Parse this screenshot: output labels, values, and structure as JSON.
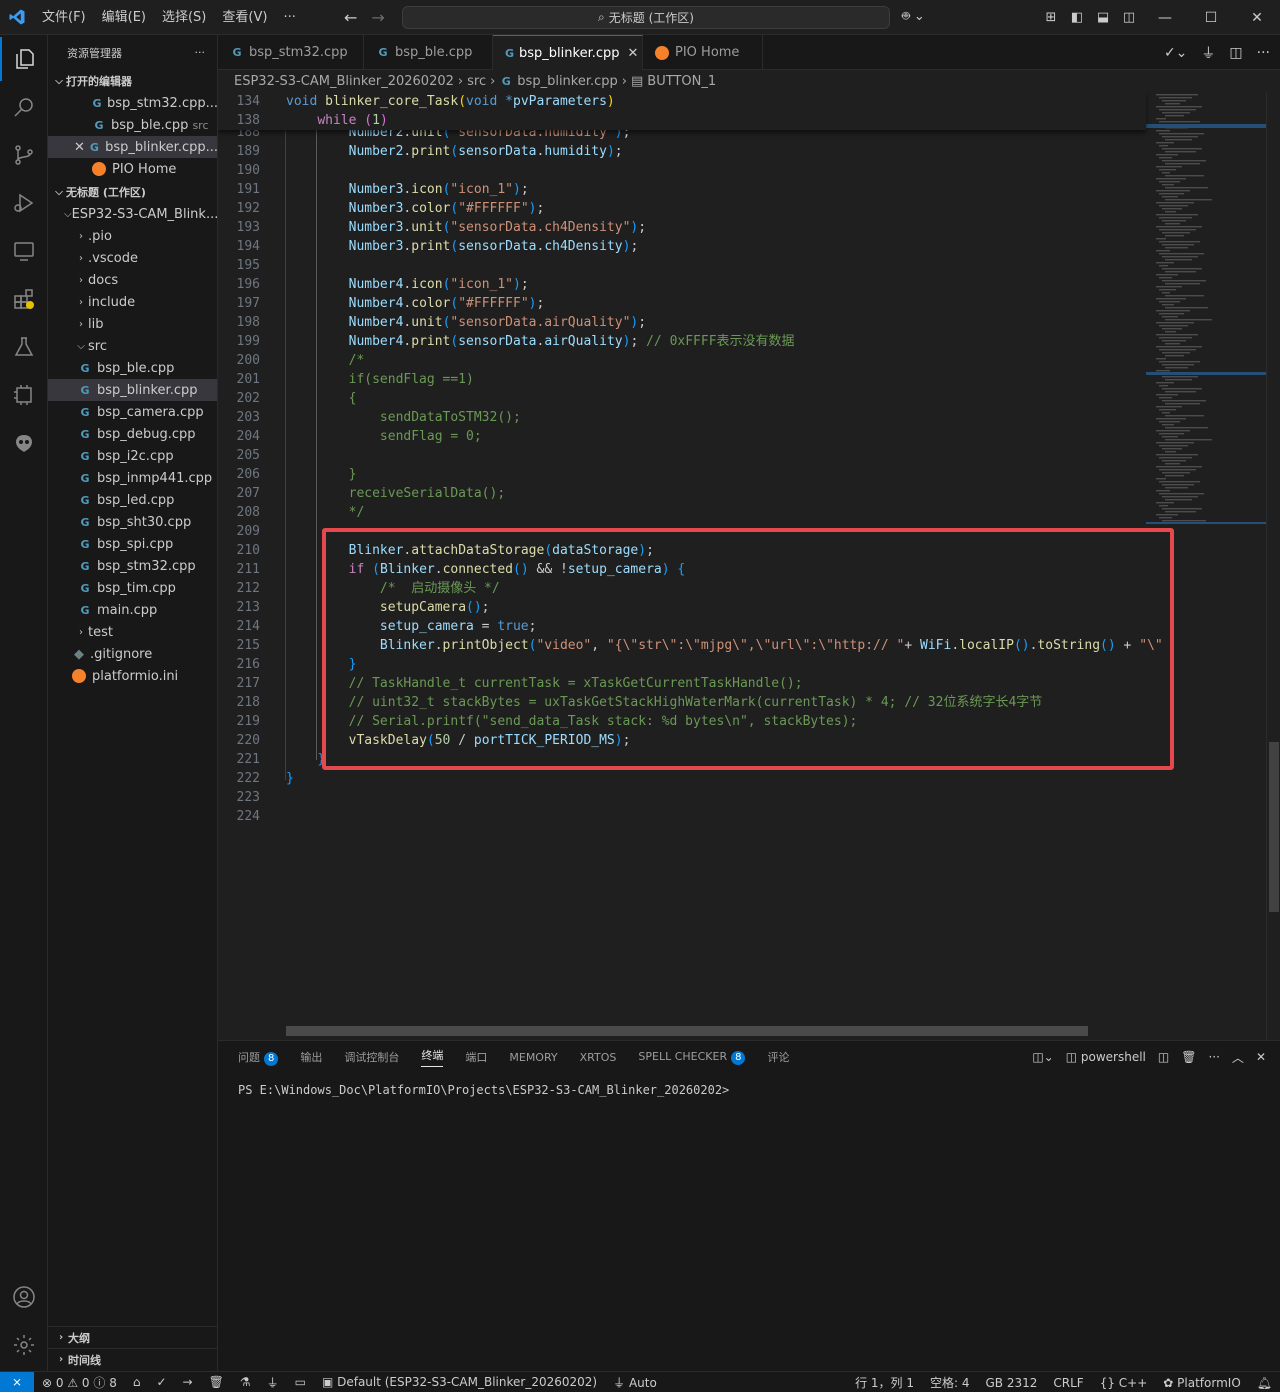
{
  "titlebar": {
    "menu": [
      "文件(F)",
      "编辑(E)",
      "选择(S)",
      "查看(V)",
      "···"
    ],
    "search": "无标题 (工作区)"
  },
  "sidebar": {
    "title": "资源管理器",
    "open_editors_title": "打开的编辑器",
    "open_editors": [
      {
        "label": "bsp_stm32.cpp...",
        "hint": ""
      },
      {
        "label": "bsp_ble.cpp",
        "hint": "src"
      },
      {
        "label": "bsp_blinker.cpp...",
        "hint": ""
      },
      {
        "label": "PIO Home",
        "hint": ""
      }
    ],
    "workspace_title": "无标题 (工作区)",
    "project": "ESP32-S3-CAM_Blink...",
    "folders": [
      ".pio",
      ".vscode",
      "docs",
      "include",
      "lib"
    ],
    "src_folder": "src",
    "src_files": [
      "bsp_ble.cpp",
      "bsp_blinker.cpp",
      "bsp_camera.cpp",
      "bsp_debug.cpp",
      "bsp_i2c.cpp",
      "bsp_inmp441.cpp",
      "bsp_led.cpp",
      "bsp_sht30.cpp",
      "bsp_spi.cpp",
      "bsp_stm32.cpp",
      "bsp_tim.cpp",
      "main.cpp"
    ],
    "test_folder": "test",
    "root_files": [
      ".gitignore",
      "platformio.ini"
    ],
    "outline": "大纲",
    "timeline": "时间线"
  },
  "tabs": [
    {
      "label": "bsp_stm32.cpp"
    },
    {
      "label": "bsp_ble.cpp"
    },
    {
      "label": "bsp_blinker.cpp"
    },
    {
      "label": "PIO Home"
    }
  ],
  "breadcrumb": {
    "project": "ESP32-S3-CAM_Blinker_20260202",
    "folder": "src",
    "file": "bsp_blinker.cpp",
    "symbol": "BUTTON_1"
  },
  "editor": {
    "sticky": [
      {
        "n": "134",
        "code": "void blinker_core_Task(void *pvParameters)"
      },
      {
        "n": "138",
        "code": "    while (1)"
      }
    ],
    "lines": [
      {
        "n": "188",
        "code": "        Number2.unit(\"sensorData.humidity\");"
      },
      {
        "n": "189",
        "code": "        Number2.print(sensorData.humidity);"
      },
      {
        "n": "190",
        "code": ""
      },
      {
        "n": "191",
        "code": "        Number3.icon(\"icon_1\");"
      },
      {
        "n": "192",
        "code": "        Number3.color(\"#FFFFFF\");"
      },
      {
        "n": "193",
        "code": "        Number3.unit(\"sensorData.ch4Density\");"
      },
      {
        "n": "194",
        "code": "        Number3.print(sensorData.ch4Density);"
      },
      {
        "n": "195",
        "code": ""
      },
      {
        "n": "196",
        "code": "        Number4.icon(\"icon_1\");"
      },
      {
        "n": "197",
        "code": "        Number4.color(\"#FFFFFF\");"
      },
      {
        "n": "198",
        "code": "        Number4.unit(\"sensorData.airQuality\");"
      },
      {
        "n": "199",
        "code": "        Number4.print(sensorData.airQuality); // 0xFFFF表示没有数据"
      },
      {
        "n": "200",
        "code": "        /*"
      },
      {
        "n": "201",
        "code": "        if(sendFlag ==1)"
      },
      {
        "n": "202",
        "code": "        {"
      },
      {
        "n": "203",
        "code": "            sendDataToSTM32();"
      },
      {
        "n": "204",
        "code": "            sendFlag = 0;"
      },
      {
        "n": "205",
        "code": ""
      },
      {
        "n": "206",
        "code": "        }"
      },
      {
        "n": "207",
        "code": "        receiveSerialData();"
      },
      {
        "n": "208",
        "code": "        */"
      },
      {
        "n": "209",
        "code": ""
      },
      {
        "n": "210",
        "code": "        Blinker.attachDataStorage(dataStorage);"
      },
      {
        "n": "211",
        "code": "        if (Blinker.connected() && !setup_camera) {"
      },
      {
        "n": "212",
        "code": "            /*  启动摄像头 */"
      },
      {
        "n": "213",
        "code": "            setupCamera();"
      },
      {
        "n": "214",
        "code": "            setup_camera = true;"
      },
      {
        "n": "215",
        "code": "            Blinker.printObject(\"video\", \"{\\\"str\\\":\\\"mjpg\\\",\\\"url\\\":\\\"http:// \"+ WiFi.localIP().toString() + \"\\\""
      },
      {
        "n": "216",
        "code": "        }"
      },
      {
        "n": "217",
        "code": "        // TaskHandle_t currentTask = xTaskGetCurrentTaskHandle();"
      },
      {
        "n": "218",
        "code": "        // uint32_t stackBytes = uxTaskGetStackHighWaterMark(currentTask) * 4; // 32位系统字长4字节"
      },
      {
        "n": "219",
        "code": "        // Serial.printf(\"send_data_Task stack: %d bytes\\n\", stackBytes);"
      },
      {
        "n": "220",
        "code": "        vTaskDelay(50 / portTICK_PERIOD_MS);"
      },
      {
        "n": "221",
        "code": "    }"
      },
      {
        "n": "222",
        "code": "}"
      },
      {
        "n": "223",
        "code": ""
      },
      {
        "n": "224",
        "code": ""
      }
    ]
  },
  "panel": {
    "tabs": [
      {
        "label": "问题",
        "badge": "8"
      },
      {
        "label": "输出",
        "badge": ""
      },
      {
        "label": "调试控制台",
        "badge": ""
      },
      {
        "label": "终端",
        "badge": ""
      },
      {
        "label": "端口",
        "badge": ""
      },
      {
        "label": "MEMORY",
        "badge": ""
      },
      {
        "label": "XRTOS",
        "badge": ""
      },
      {
        "label": "SPELL CHECKER",
        "badge": "8"
      },
      {
        "label": "评论",
        "badge": ""
      }
    ],
    "shell": "powershell",
    "terminal_text": "PS E:\\Windows_Doc\\PlatformIO\\Projects\\ESP32-S3-CAM_Blinker_20260202>"
  },
  "statusbar": {
    "errors": "0",
    "warnings": "0",
    "info": "8",
    "env": "Default (ESP32-S3-CAM_Blinker_20260202)",
    "port": "Auto",
    "position": "行 1，列 1",
    "indent": "空格: 4",
    "encoding": "GB 2312",
    "eol": "CRLF",
    "language": "C++",
    "platform": "PlatformIO"
  },
  "colors": {
    "accent": "#0078d4",
    "highlight_box": "#e5484d"
  }
}
